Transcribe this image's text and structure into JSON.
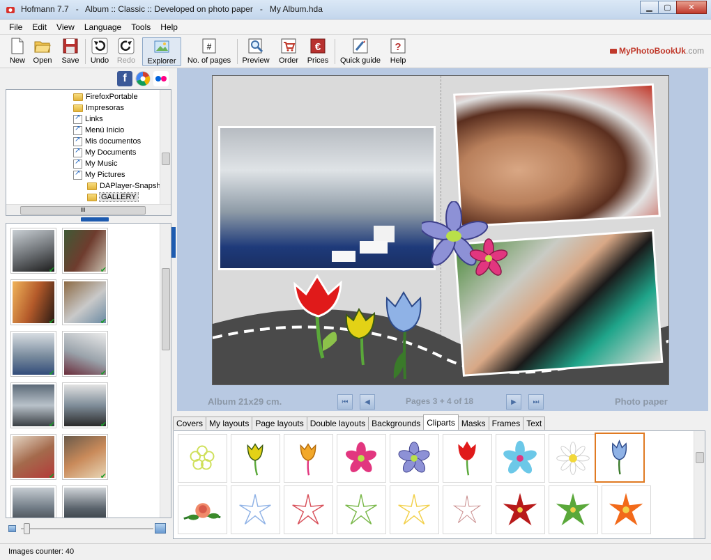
{
  "window": {
    "title": "Hofmann 7.7   -   Album :: Classic :: Developed on photo paper   -   My Album.hda"
  },
  "menu": [
    "File",
    "Edit",
    "View",
    "Language",
    "Tools",
    "Help"
  ],
  "toolbar": {
    "new": "New",
    "open": "Open",
    "save": "Save",
    "undo": "Undo",
    "redo": "Redo",
    "explorer": "Explorer",
    "pages": "No. of pages",
    "preview": "Preview",
    "order": "Order",
    "prices": "Prices",
    "guide": "Quick guide",
    "help": "Help"
  },
  "brand": {
    "name": "MyPhotoBookUk",
    "tld": ".com"
  },
  "tree": {
    "items": [
      "FirefoxPortable",
      "Impresoras",
      "Links",
      "Menú Inicio",
      "Mis documentos",
      "My Documents",
      "My Music",
      "My Pictures",
      "DAPlayer-Snapsh",
      "GALLERY"
    ],
    "hscroll_grip": "III"
  },
  "thumbnail_check": "✔",
  "status": {
    "counter": "Images counter: 40"
  },
  "album": {
    "size": "Album 21x29 cm.",
    "pages": "Pages 3 + 4 of 18",
    "paper": "Photo paper"
  },
  "tabs": [
    "Covers",
    "My layouts",
    "Page layouts",
    "Double layouts",
    "Backgrounds",
    "Cliparts",
    "Masks",
    "Frames",
    "Text"
  ],
  "active_tab": "Cliparts",
  "colors": {
    "accent": "#1d5bb0",
    "selection": "#e07a22",
    "workspace": "#b8c9e2"
  }
}
